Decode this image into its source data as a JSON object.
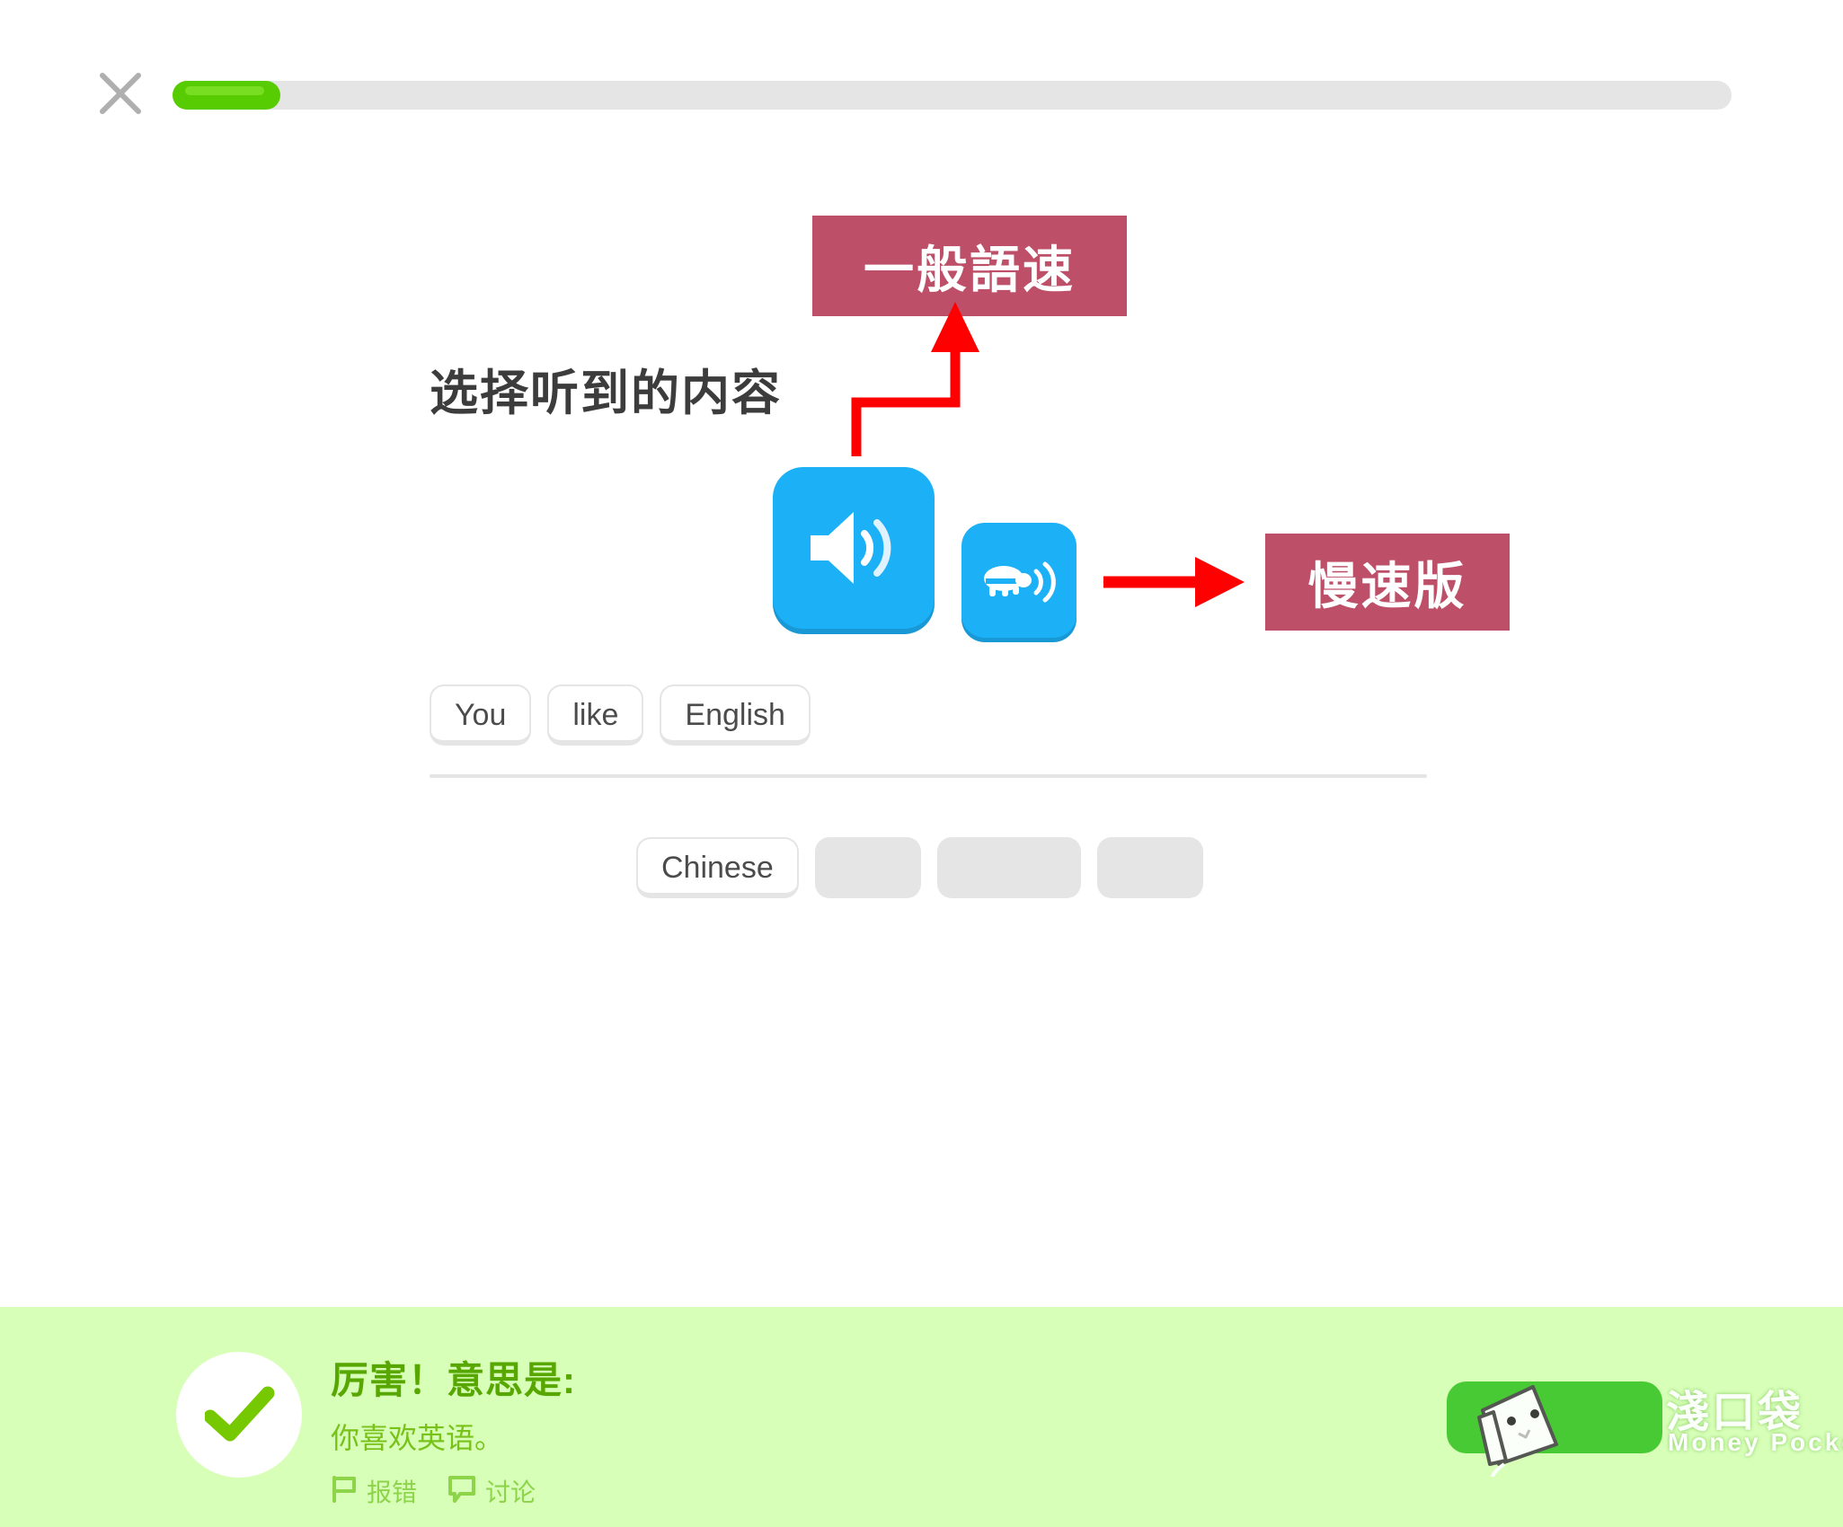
{
  "colors": {
    "duo_green": "#58cc02",
    "duo_blue": "#1cb0f6",
    "annotation_red_box": "#bd5068",
    "annotation_arrow": "#ff0000",
    "banner_bg": "#d7ffb8",
    "banner_text": "#58a700",
    "tile_border": "#e5e5e5",
    "watermark_green": "#3cc62a"
  },
  "topbar": {
    "close_icon": "close-x-icon",
    "progress": {
      "percent": 7,
      "track_color": "#e5e5e5",
      "fill_color": "#58cc02"
    }
  },
  "exercise": {
    "prompt_title": "选择听到的内容",
    "audio_normal": {
      "icon": "speaker-icon",
      "label_semantic": "play-normal-speed"
    },
    "audio_slow": {
      "icon": "turtle-speaker-icon",
      "label_semantic": "play-slow-speed"
    },
    "answer_tiles": [
      "You",
      "like",
      "English"
    ],
    "word_bank": [
      {
        "label": "Chinese",
        "used": false
      },
      {
        "label": "",
        "used": true
      },
      {
        "label": "",
        "used": true
      },
      {
        "label": "",
        "used": true
      }
    ]
  },
  "annotations": [
    {
      "id": "annotation-normal-speed",
      "text": "一般語速",
      "arrow": "elbow-arrow-up",
      "points_to": "audio_normal"
    },
    {
      "id": "annotation-slow-speed",
      "text": "慢速版",
      "arrow": "straight-arrow-right",
      "points_to": "audio_slow"
    }
  ],
  "result_banner": {
    "status_icon": "check-circle-icon",
    "title": "厉害！意思是:",
    "subtitle": "你喜欢英语。",
    "links": [
      {
        "icon": "flag-icon",
        "label": "报错"
      },
      {
        "icon": "speech-bubble-icon",
        "label": "讨论"
      }
    ]
  },
  "watermark": {
    "mascot_icon": "paper-mascot-icon",
    "name_cn": "淺口袋",
    "name_en": "Money Pocket"
  }
}
